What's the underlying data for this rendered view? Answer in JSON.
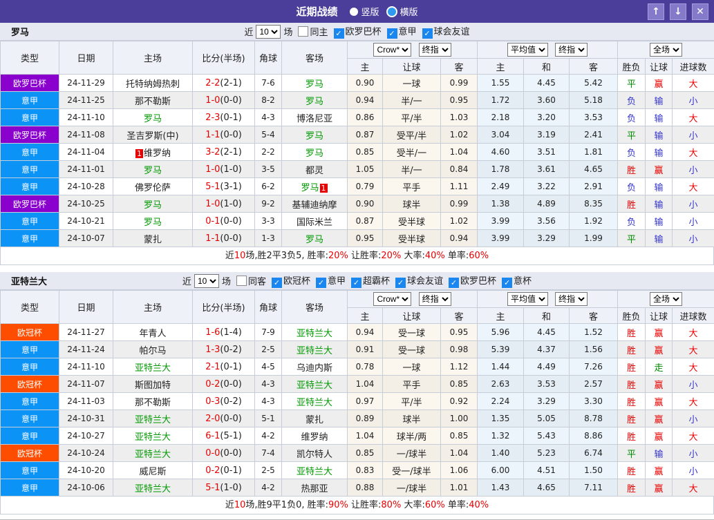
{
  "titlebar": {
    "title": "近期战绩",
    "vertical_label": "竖版",
    "horizontal_label": "横版"
  },
  "icons": {
    "check": "✓",
    "up": "↑",
    "down": "↓",
    "close": "✕"
  },
  "columns": {
    "type": "类型",
    "date": "日期",
    "home": "主场",
    "score": "比分(半场)",
    "corner": "角球",
    "away": "客场",
    "h": "主",
    "handicap": "让球",
    "a": "客",
    "avg_h": "主",
    "avg_d": "和",
    "avg_a": "客",
    "wdl": "胜负",
    "let": "让球",
    "goals": "进球数"
  },
  "selects": {
    "crow": "Crow*",
    "final1": "终指",
    "avg": "平均值",
    "final2": "终指",
    "full": "全场"
  },
  "filter_labels": {
    "near": "近",
    "games_unit": "场"
  },
  "colors": {
    "titlebar_bg": "#4b3e9b",
    "button_bg": "#837ac9",
    "checkbox_blue": "#1a86f0",
    "team_green": "#009900",
    "score_red": "#e80000",
    "league": {
      "欧罗巴杯": "#8a00cc",
      "意甲": "#0b93f6",
      "欧冠杯": "#ff4d00"
    },
    "result": {
      "red": "#e80000",
      "green": "#008800",
      "blue": "#3535cc"
    }
  },
  "result_colors": {
    "胜": "red",
    "平": "green",
    "负": "blue",
    "赢": "red",
    "输": "blue",
    "走": "green",
    "大": "red",
    "小": "blue"
  },
  "teams": [
    {
      "name": "罗马",
      "filter": {
        "games": "10",
        "same_label": "同主",
        "same_checked": false,
        "leagues": [
          {
            "label": "欧罗巴杯",
            "checked": true
          },
          {
            "label": "意甲",
            "checked": true
          },
          {
            "label": "球会友谊",
            "checked": true
          }
        ]
      },
      "rows": [
        {
          "league": "欧罗巴杯",
          "date": "24-11-29",
          "home": "托特纳姆热刺",
          "score": "2-2",
          "half": "(2-1)",
          "corner": "7-6",
          "away": "罗马",
          "away_team": true,
          "o1": "0.90",
          "hcap": "一球",
          "o2": "0.99",
          "m1": "1.55",
          "m2": "4.45",
          "m3": "5.42",
          "r1": "平",
          "r2": "赢",
          "r3": "大"
        },
        {
          "league": "意甲",
          "date": "24-11-25",
          "home": "那不勒斯",
          "score": "1-0",
          "half": "(0-0)",
          "corner": "8-2",
          "away": "罗马",
          "away_team": true,
          "o1": "0.94",
          "hcap": "半/一",
          "o2": "0.95",
          "m1": "1.72",
          "m2": "3.60",
          "m3": "5.18",
          "r1": "负",
          "r2": "输",
          "r3": "小"
        },
        {
          "league": "意甲",
          "date": "24-11-10",
          "home": "罗马",
          "home_team": true,
          "score": "2-3",
          "half": "(0-1)",
          "corner": "4-3",
          "away": "博洛尼亚",
          "o1": "0.86",
          "hcap": "平/半",
          "o2": "1.03",
          "m1": "2.18",
          "m2": "3.20",
          "m3": "3.53",
          "r1": "负",
          "r2": "输",
          "r3": "大"
        },
        {
          "league": "欧罗巴杯",
          "date": "24-11-08",
          "home": "圣吉罗斯(中)",
          "score": "1-1",
          "half": "(0-0)",
          "corner": "5-4",
          "away": "罗马",
          "away_team": true,
          "o1": "0.87",
          "hcap": "受平/半",
          "o2": "1.02",
          "m1": "3.04",
          "m2": "3.19",
          "m3": "2.41",
          "r1": "平",
          "r2": "输",
          "r3": "小"
        },
        {
          "league": "意甲",
          "date": "24-11-04",
          "home": "维罗纳",
          "home_card": "1",
          "home_card_pos": "pre",
          "score": "3-2",
          "half": "(2-1)",
          "corner": "2-2",
          "away": "罗马",
          "away_team": true,
          "o1": "0.85",
          "hcap": "受半/一",
          "o2": "1.04",
          "m1": "4.60",
          "m2": "3.51",
          "m3": "1.81",
          "r1": "负",
          "r2": "输",
          "r3": "大"
        },
        {
          "league": "意甲",
          "date": "24-11-01",
          "home": "罗马",
          "home_team": true,
          "score": "1-0",
          "half": "(1-0)",
          "corner": "3-5",
          "away": "都灵",
          "o1": "1.05",
          "hcap": "半/一",
          "o2": "0.84",
          "m1": "1.78",
          "m2": "3.61",
          "m3": "4.65",
          "r1": "胜",
          "r2": "赢",
          "r3": "小"
        },
        {
          "league": "意甲",
          "date": "24-10-28",
          "home": "佛罗伦萨",
          "score": "5-1",
          "half": "(3-1)",
          "corner": "6-2",
          "away": "罗马",
          "away_team": true,
          "away_card": "1",
          "away_card_pos": "post",
          "o1": "0.79",
          "hcap": "平手",
          "o2": "1.11",
          "m1": "2.49",
          "m2": "3.22",
          "m3": "2.91",
          "r1": "负",
          "r2": "输",
          "r3": "大"
        },
        {
          "league": "欧罗巴杯",
          "date": "24-10-25",
          "home": "罗马",
          "home_team": true,
          "score": "1-0",
          "half": "(1-0)",
          "corner": "9-2",
          "away": "基辅迪纳摩",
          "o1": "0.90",
          "hcap": "球半",
          "o2": "0.99",
          "m1": "1.38",
          "m2": "4.89",
          "m3": "8.35",
          "r1": "胜",
          "r2": "输",
          "r3": "小"
        },
        {
          "league": "意甲",
          "date": "24-10-21",
          "home": "罗马",
          "home_team": true,
          "score": "0-1",
          "half": "(0-0)",
          "corner": "3-3",
          "away": "国际米兰",
          "o1": "0.87",
          "hcap": "受半球",
          "o2": "1.02",
          "m1": "3.99",
          "m2": "3.56",
          "m3": "1.92",
          "r1": "负",
          "r2": "输",
          "r3": "小"
        },
        {
          "league": "意甲",
          "date": "24-10-07",
          "home": "蒙扎",
          "score": "1-1",
          "half": "(0-0)",
          "corner": "1-3",
          "away": "罗马",
          "away_team": true,
          "o1": "0.95",
          "hcap": "受半球",
          "o2": "0.94",
          "m1": "3.99",
          "m2": "3.29",
          "m3": "1.99",
          "r1": "平",
          "r2": "输",
          "r3": "小"
        }
      ],
      "summary": [
        {
          "t": "近",
          "r": false
        },
        {
          "t": "10",
          "r": true
        },
        {
          "t": "场,胜2平3负5, 胜率:",
          "r": false
        },
        {
          "t": "20%",
          "r": true
        },
        {
          "t": " 让胜率:",
          "r": false
        },
        {
          "t": "20%",
          "r": true
        },
        {
          "t": " 大率:",
          "r": false
        },
        {
          "t": "40%",
          "r": true
        },
        {
          "t": " 单率:",
          "r": false
        },
        {
          "t": "60%",
          "r": true
        }
      ]
    },
    {
      "name": "亚特兰大",
      "filter": {
        "games": "10",
        "same_label": "同客",
        "same_checked": false,
        "leagues": [
          {
            "label": "欧冠杯",
            "checked": true
          },
          {
            "label": "意甲",
            "checked": true
          },
          {
            "label": "超霸杯",
            "checked": true
          },
          {
            "label": "球会友谊",
            "checked": true
          },
          {
            "label": "欧罗巴杯",
            "checked": true
          },
          {
            "label": "意杯",
            "checked": true
          }
        ]
      },
      "rows": [
        {
          "league": "欧冠杯",
          "date": "24-11-27",
          "home": "年青人",
          "score": "1-6",
          "half": "(1-4)",
          "corner": "7-9",
          "away": "亚特兰大",
          "away_team": true,
          "o1": "0.94",
          "hcap": "受一球",
          "o2": "0.95",
          "m1": "5.96",
          "m2": "4.45",
          "m3": "1.52",
          "r1": "胜",
          "r2": "赢",
          "r3": "大"
        },
        {
          "league": "意甲",
          "date": "24-11-24",
          "home": "帕尔马",
          "score": "1-3",
          "half": "(0-2)",
          "corner": "2-5",
          "away": "亚特兰大",
          "away_team": true,
          "o1": "0.91",
          "hcap": "受一球",
          "o2": "0.98",
          "m1": "5.39",
          "m2": "4.37",
          "m3": "1.56",
          "r1": "胜",
          "r2": "赢",
          "r3": "大"
        },
        {
          "league": "意甲",
          "date": "24-11-10",
          "home": "亚特兰大",
          "home_team": true,
          "score": "2-1",
          "half": "(0-1)",
          "corner": "4-5",
          "away": "乌迪内斯",
          "o1": "0.78",
          "hcap": "一球",
          "o2": "1.12",
          "m1": "1.44",
          "m2": "4.49",
          "m3": "7.26",
          "r1": "胜",
          "r2": "走",
          "r3": "大"
        },
        {
          "league": "欧冠杯",
          "date": "24-11-07",
          "home": "斯图加特",
          "score": "0-2",
          "half": "(0-0)",
          "corner": "4-3",
          "away": "亚特兰大",
          "away_team": true,
          "o1": "1.04",
          "hcap": "平手",
          "o2": "0.85",
          "m1": "2.63",
          "m2": "3.53",
          "m3": "2.57",
          "r1": "胜",
          "r2": "赢",
          "r3": "小"
        },
        {
          "league": "意甲",
          "date": "24-11-03",
          "home": "那不勒斯",
          "score": "0-3",
          "half": "(0-2)",
          "corner": "4-3",
          "away": "亚特兰大",
          "away_team": true,
          "o1": "0.97",
          "hcap": "平/半",
          "o2": "0.92",
          "m1": "2.24",
          "m2": "3.29",
          "m3": "3.30",
          "r1": "胜",
          "r2": "赢",
          "r3": "大"
        },
        {
          "league": "意甲",
          "date": "24-10-31",
          "home": "亚特兰大",
          "home_team": true,
          "score": "2-0",
          "half": "(0-0)",
          "corner": "5-1",
          "away": "蒙扎",
          "o1": "0.89",
          "hcap": "球半",
          "o2": "1.00",
          "m1": "1.35",
          "m2": "5.05",
          "m3": "8.78",
          "r1": "胜",
          "r2": "赢",
          "r3": "小"
        },
        {
          "league": "意甲",
          "date": "24-10-27",
          "home": "亚特兰大",
          "home_team": true,
          "score": "6-1",
          "half": "(5-1)",
          "corner": "4-2",
          "away": "维罗纳",
          "o1": "1.04",
          "hcap": "球半/两",
          "o2": "0.85",
          "m1": "1.32",
          "m2": "5.43",
          "m3": "8.86",
          "r1": "胜",
          "r2": "赢",
          "r3": "大"
        },
        {
          "league": "欧冠杯",
          "date": "24-10-24",
          "home": "亚特兰大",
          "home_team": true,
          "score": "0-0",
          "half": "(0-0)",
          "corner": "7-4",
          "away": "凯尔特人",
          "o1": "0.85",
          "hcap": "一/球半",
          "o2": "1.04",
          "m1": "1.40",
          "m2": "5.23",
          "m3": "6.74",
          "r1": "平",
          "r2": "输",
          "r3": "小"
        },
        {
          "league": "意甲",
          "date": "24-10-20",
          "home": "威尼斯",
          "score": "0-2",
          "half": "(0-1)",
          "corner": "2-5",
          "away": "亚特兰大",
          "away_team": true,
          "o1": "0.83",
          "hcap": "受一/球半",
          "o2": "1.06",
          "m1": "6.00",
          "m2": "4.51",
          "m3": "1.50",
          "r1": "胜",
          "r2": "赢",
          "r3": "小"
        },
        {
          "league": "意甲",
          "date": "24-10-06",
          "home": "亚特兰大",
          "home_team": true,
          "score": "5-1",
          "half": "(1-0)",
          "corner": "4-2",
          "away": "热那亚",
          "o1": "0.88",
          "hcap": "一/球半",
          "o2": "1.01",
          "m1": "1.43",
          "m2": "4.65",
          "m3": "7.11",
          "r1": "胜",
          "r2": "赢",
          "r3": "大"
        }
      ],
      "summary": [
        {
          "t": "近",
          "r": false
        },
        {
          "t": "10",
          "r": true
        },
        {
          "t": "场,胜9平1负0, 胜率:",
          "r": false
        },
        {
          "t": "90%",
          "r": true
        },
        {
          "t": " 让胜率:",
          "r": false
        },
        {
          "t": "80%",
          "r": true
        },
        {
          "t": " 大率:",
          "r": false
        },
        {
          "t": "60%",
          "r": true
        },
        {
          "t": " 单率:",
          "r": false
        },
        {
          "t": "40%",
          "r": true
        }
      ]
    }
  ]
}
